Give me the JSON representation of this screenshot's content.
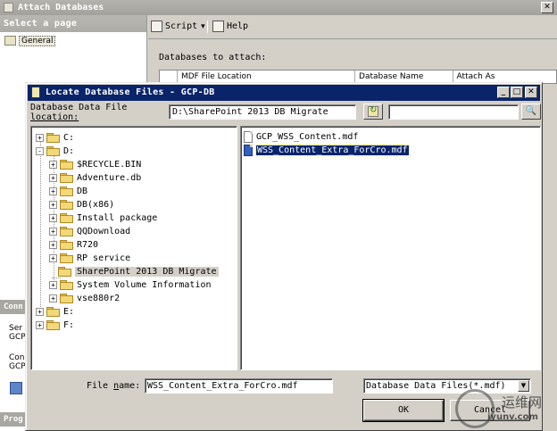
{
  "background_window": {
    "title": "Attach Databases",
    "close_glyph": "✕",
    "select_page_header": "Select a page",
    "pages": [
      {
        "label": "General"
      }
    ],
    "connection_header": "Conn",
    "server_label_abbr": "Ser",
    "server_value_abbr": "GCP",
    "connection_label_abbr": "Con",
    "connection_value_abbr": "GCP",
    "progress_header": "Prog",
    "toolbar": {
      "script_label": "Script",
      "script_dropdown_glyph": "▾",
      "help_label": "Help"
    },
    "databases_to_attach_label": "Databases to attach:",
    "grid_columns": [
      "MDF File Location",
      "Database Name",
      "Attach As"
    ]
  },
  "dialog": {
    "title": "Locate Database Files - GCP-DB",
    "window_buttons": {
      "minimize": "_",
      "maximize": "□",
      "close": "✕"
    },
    "path_label_line1": "Database Data File",
    "path_label_line2": "location:",
    "path_value": "D:\\SharePoint 2013 DB Migrate",
    "search_value": "",
    "search_glyph": "🔍",
    "tree": {
      "drives": [
        {
          "label": "C:",
          "expander": "+"
        },
        {
          "label": "D:",
          "expander": "-"
        },
        {
          "label": "E:",
          "expander": "+"
        },
        {
          "label": "F:",
          "expander": "+"
        }
      ],
      "d_children": [
        {
          "label": "$RECYCLE.BIN",
          "expander": "+"
        },
        {
          "label": "Adventure.db",
          "expander": "+"
        },
        {
          "label": "DB",
          "expander": "+"
        },
        {
          "label": "DB(x86)",
          "expander": "+"
        },
        {
          "label": "Install package",
          "expander": "+"
        },
        {
          "label": "QQDownload",
          "expander": "+"
        },
        {
          "label": "R720",
          "expander": "+"
        },
        {
          "label": "RP service",
          "expander": "+"
        },
        {
          "label": "SharePoint 2013 DB Migrate",
          "expander": ""
        },
        {
          "label": "System Volume Information",
          "expander": "+"
        },
        {
          "label": "vse880r2",
          "expander": "+"
        }
      ]
    },
    "files": [
      {
        "name": "GCP_WSS_Content.mdf"
      },
      {
        "name": "WSS_Content_Extra_ForCro.mdf"
      }
    ],
    "file_name_label_pre": "File ",
    "file_name_label_access": "n",
    "file_name_label_post": "ame:",
    "file_name_value": "WSS_Content_Extra_ForCro.mdf",
    "file_type_value": "Database Data Files(*.mdf)",
    "file_type_dropdown_glyph": "▼",
    "ok_label": "OK",
    "cancel_label": "Cancel"
  },
  "watermark": {
    "cn_text": "运维网",
    "url_text": "iyunv.com"
  }
}
